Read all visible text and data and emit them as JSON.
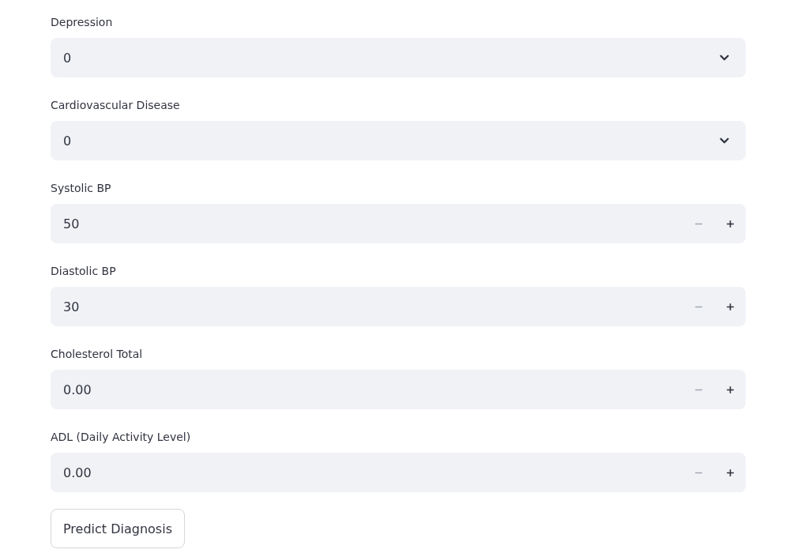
{
  "fields": [
    {
      "kind": "select",
      "label": "Depression",
      "value": "0"
    },
    {
      "kind": "select",
      "label": "Cardiovascular Disease",
      "value": "0"
    },
    {
      "kind": "number",
      "label": "Systolic BP",
      "value": "50",
      "decrement_disabled": true,
      "increment_disabled": false
    },
    {
      "kind": "number",
      "label": "Diastolic BP",
      "value": "30",
      "decrement_disabled": true,
      "increment_disabled": false
    },
    {
      "kind": "number",
      "label": "Cholesterol Total",
      "value": "0.00",
      "decrement_disabled": true,
      "increment_disabled": false
    },
    {
      "kind": "number",
      "label": "ADL (Daily Activity Level)",
      "value": "0.00",
      "decrement_disabled": true,
      "increment_disabled": false
    }
  ],
  "submit_button": {
    "label": "Predict Diagnosis"
  }
}
